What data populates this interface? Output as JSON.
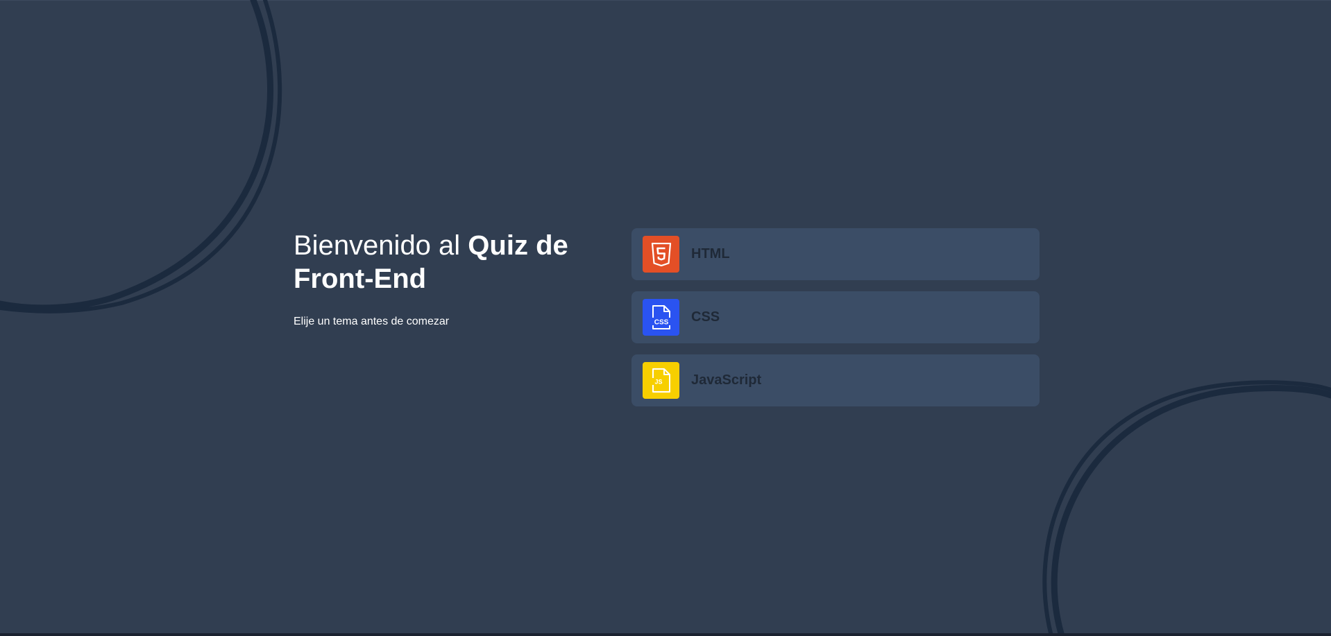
{
  "welcome": {
    "title_regular": "Bienvenido al ",
    "title_bold": "Quiz de Front-End",
    "subtitle": "Elije un tema antes de comezar"
  },
  "topics": [
    {
      "label": "HTML",
      "icon": "html5-icon",
      "color": "#e34f26",
      "glyph": "5"
    },
    {
      "label": "CSS",
      "icon": "css-file-icon",
      "color": "#2a53f1",
      "glyph": "CSS"
    },
    {
      "label": "JavaScript",
      "icon": "js-file-icon",
      "color": "#f7cf00",
      "glyph": "JS"
    }
  ],
  "colors": {
    "background": "#313e51",
    "card": "#3b4d66",
    "card_text": "#1f2937",
    "decoration": "#1b2a3e"
  }
}
